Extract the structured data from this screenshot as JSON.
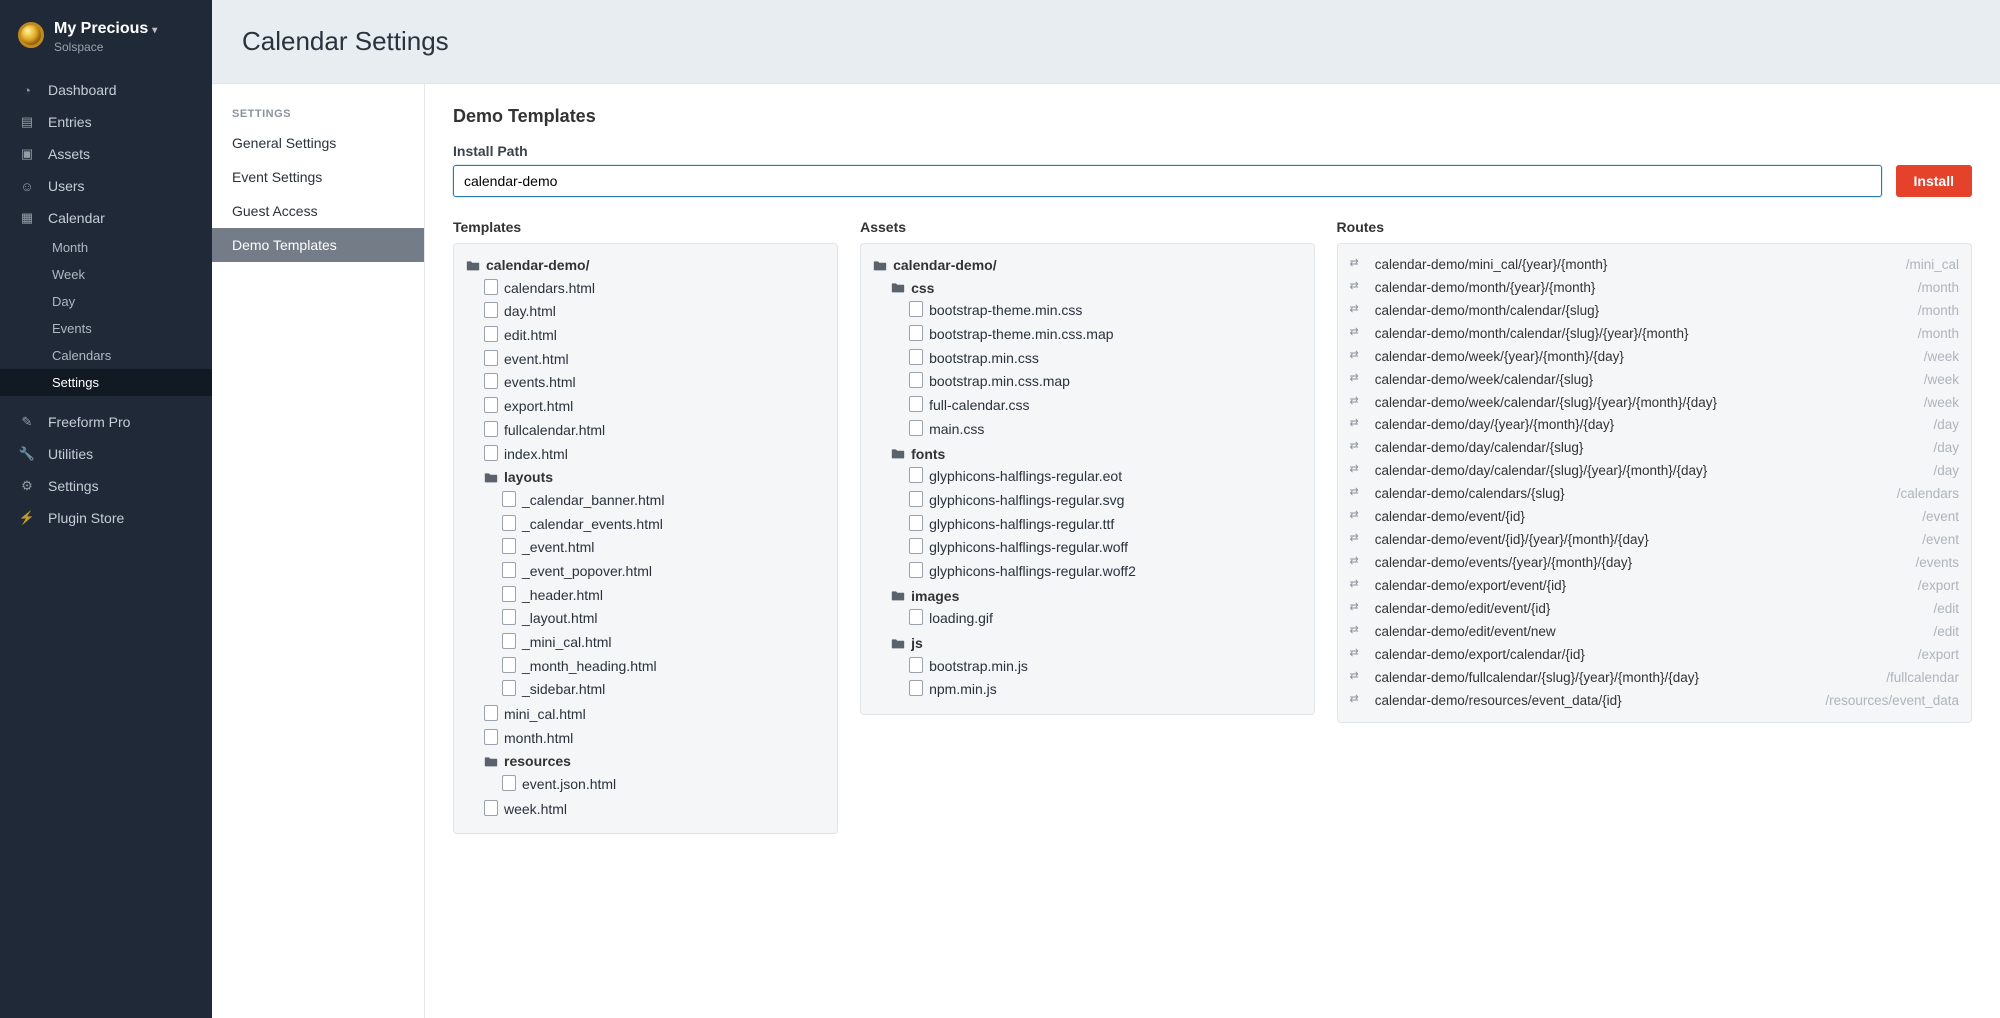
{
  "site": {
    "name": "My Precious",
    "org": "Solspace"
  },
  "nav": {
    "items": [
      {
        "id": "dashboard",
        "label": "Dashboard",
        "icon": "gauge"
      },
      {
        "id": "entries",
        "label": "Entries",
        "icon": "newspaper"
      },
      {
        "id": "assets",
        "label": "Assets",
        "icon": "image"
      },
      {
        "id": "users",
        "label": "Users",
        "icon": "users"
      },
      {
        "id": "calendar",
        "label": "Calendar",
        "icon": "calendar",
        "children": [
          {
            "id": "month",
            "label": "Month"
          },
          {
            "id": "week",
            "label": "Week"
          },
          {
            "id": "day",
            "label": "Day"
          },
          {
            "id": "events",
            "label": "Events"
          },
          {
            "id": "calendars",
            "label": "Calendars"
          },
          {
            "id": "settings",
            "label": "Settings",
            "active": true
          }
        ]
      },
      {
        "id": "freeform",
        "label": "Freeform Pro",
        "icon": "clipboard"
      },
      {
        "id": "utilities",
        "label": "Utilities",
        "icon": "wrench"
      },
      {
        "id": "settings",
        "label": "Settings",
        "icon": "gear"
      },
      {
        "id": "pluginstore",
        "label": "Plugin Store",
        "icon": "plug"
      }
    ]
  },
  "page_title": "Calendar Settings",
  "settings_nav": {
    "heading": "SETTINGS",
    "items": [
      {
        "id": "general",
        "label": "General Settings"
      },
      {
        "id": "event",
        "label": "Event Settings"
      },
      {
        "id": "guest",
        "label": "Guest Access"
      },
      {
        "id": "demo",
        "label": "Demo Templates",
        "active": true
      }
    ]
  },
  "content": {
    "heading": "Demo Templates",
    "install_path_label": "Install Path",
    "install_path_value": "calendar-demo",
    "install_button": "Install",
    "columns": {
      "templates": "Templates",
      "assets": "Assets",
      "routes": "Routes"
    },
    "templates_tree": {
      "name": "calendar-demo/",
      "children": [
        {
          "name": "calendars.html"
        },
        {
          "name": "day.html"
        },
        {
          "name": "edit.html"
        },
        {
          "name": "event.html"
        },
        {
          "name": "events.html"
        },
        {
          "name": "export.html"
        },
        {
          "name": "fullcalendar.html"
        },
        {
          "name": "index.html"
        },
        {
          "name": "layouts",
          "folder": true,
          "children": [
            {
              "name": "_calendar_banner.html"
            },
            {
              "name": "_calendar_events.html"
            },
            {
              "name": "_event.html"
            },
            {
              "name": "_event_popover.html"
            },
            {
              "name": "_header.html"
            },
            {
              "name": "_layout.html"
            },
            {
              "name": "_mini_cal.html"
            },
            {
              "name": "_month_heading.html"
            },
            {
              "name": "_sidebar.html"
            }
          ]
        },
        {
          "name": "mini_cal.html"
        },
        {
          "name": "month.html"
        },
        {
          "name": "resources",
          "folder": true,
          "children": [
            {
              "name": "event.json.html"
            }
          ]
        },
        {
          "name": "week.html"
        }
      ]
    },
    "assets_tree": {
      "name": "calendar-demo/",
      "children": [
        {
          "name": "css",
          "folder": true,
          "children": [
            {
              "name": "bootstrap-theme.min.css"
            },
            {
              "name": "bootstrap-theme.min.css.map"
            },
            {
              "name": "bootstrap.min.css"
            },
            {
              "name": "bootstrap.min.css.map"
            },
            {
              "name": "full-calendar.css"
            },
            {
              "name": "main.css"
            }
          ]
        },
        {
          "name": "fonts",
          "folder": true,
          "children": [
            {
              "name": "glyphicons-halflings-regular.eot"
            },
            {
              "name": "glyphicons-halflings-regular.svg"
            },
            {
              "name": "glyphicons-halflings-regular.ttf"
            },
            {
              "name": "glyphicons-halflings-regular.woff"
            },
            {
              "name": "glyphicons-halflings-regular.woff2"
            }
          ]
        },
        {
          "name": "images",
          "folder": true,
          "children": [
            {
              "name": "loading.gif"
            }
          ]
        },
        {
          "name": "js",
          "folder": true,
          "children": [
            {
              "name": "bootstrap.min.js"
            },
            {
              "name": "npm.min.js"
            }
          ]
        }
      ]
    },
    "routes": [
      {
        "path": "calendar-demo/mini_cal/{year}/{month}",
        "target": "/mini_cal"
      },
      {
        "path": "calendar-demo/month/{year}/{month}",
        "target": "/month"
      },
      {
        "path": "calendar-demo/month/calendar/{slug}",
        "target": "/month"
      },
      {
        "path": "calendar-demo/month/calendar/{slug}/{year}/{month}",
        "target": "/month"
      },
      {
        "path": "calendar-demo/week/{year}/{month}/{day}",
        "target": "/week"
      },
      {
        "path": "calendar-demo/week/calendar/{slug}",
        "target": "/week"
      },
      {
        "path": "calendar-demo/week/calendar/{slug}/{year}/{month}/{day}",
        "target": "/week"
      },
      {
        "path": "calendar-demo/day/{year}/{month}/{day}",
        "target": "/day"
      },
      {
        "path": "calendar-demo/day/calendar/{slug}",
        "target": "/day"
      },
      {
        "path": "calendar-demo/day/calendar/{slug}/{year}/{month}/{day}",
        "target": "/day"
      },
      {
        "path": "calendar-demo/calendars/{slug}",
        "target": "/calendars"
      },
      {
        "path": "calendar-demo/event/{id}",
        "target": "/event"
      },
      {
        "path": "calendar-demo/event/{id}/{year}/{month}/{day}",
        "target": "/event"
      },
      {
        "path": "calendar-demo/events/{year}/{month}/{day}",
        "target": "/events"
      },
      {
        "path": "calendar-demo/export/event/{id}",
        "target": "/export"
      },
      {
        "path": "calendar-demo/edit/event/{id}",
        "target": "/edit"
      },
      {
        "path": "calendar-demo/edit/event/new",
        "target": "/edit"
      },
      {
        "path": "calendar-demo/export/calendar/{id}",
        "target": "/export"
      },
      {
        "path": "calendar-demo/fullcalendar/{slug}/{year}/{month}/{day}",
        "target": "/fullcalendar"
      },
      {
        "path": "calendar-demo/resources/event_data/{id}",
        "target": "/resources/event_data"
      }
    ]
  }
}
